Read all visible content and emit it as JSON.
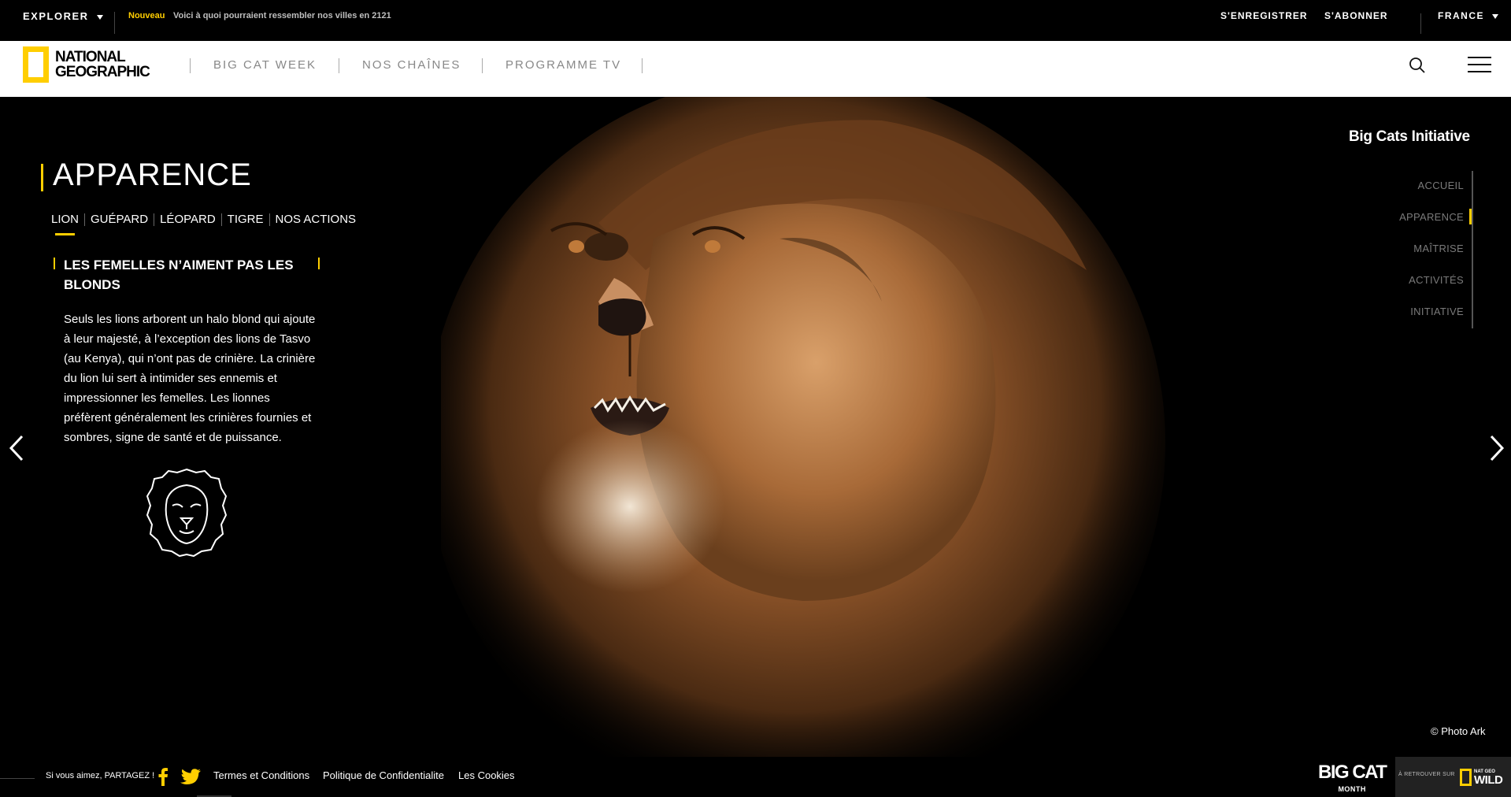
{
  "topbar": {
    "explore_label": "EXPLORER",
    "new_tag": "Nouveau",
    "new_text": "Voici à quoi pourraient ressembler nos villes en 2121",
    "register_label": "S'ENREGISTRER",
    "subscribe_label": "S'ABONNER",
    "country_label": "FRANCE"
  },
  "navbar": {
    "logo_line1": "NATIONAL",
    "logo_line2": "GEOGRAPHIC",
    "items": [
      "BIG CAT WEEK",
      "NOS CHAÎNES",
      "PROGRAMME TV"
    ]
  },
  "hero": {
    "section_title": "APPARENCE",
    "tabs": [
      "LION",
      "GUÉPARD",
      "LÉOPARD",
      "TIGRE",
      "NOS ACTIONS"
    ],
    "active_tab": "LION",
    "article_heading": "LES FEMELLES N’AIMENT PAS LES BLONDS",
    "article_body": "Seuls les lions arborent un halo blond qui ajoute à leur majesté, à l’exception des lions de Tasvo (au Kenya), qui n’ont pas de crinière. La crinière du lion lui sert à intimider ses ennemis et impressionner les femelles. Les lionnes préfèrent généralement les crinières fournies et sombres, signe de santé et de puissance.",
    "photo_credit": "© Photo Ark"
  },
  "side_nav": {
    "title": "Big Cats Initiative",
    "items": [
      "ACCUEIL",
      "APPARENCE",
      "MAÎTRISE",
      "ACTIVITÉS",
      "INITIATIVE"
    ],
    "active": "APPARENCE"
  },
  "footer": {
    "share_text": "Si vous aimez, PARTAGEZ !",
    "links": [
      "Termes et Conditions",
      "Politique de Confidentialite",
      "Les Cookies"
    ],
    "bigcat_line1": "BIG CAT",
    "bigcat_line2": "MONTH",
    "retrouver": "À RETROUVER SUR",
    "wild_mini": "NAT GEO",
    "wild_label": "WILD"
  },
  "colors": {
    "accent": "#ffce00",
    "background": "#000000",
    "nav_background": "#ffffff",
    "muted_text": "#888888"
  },
  "icons": [
    "chevron-down-icon",
    "search-icon",
    "hamburger-menu-icon",
    "chevron-left-icon",
    "chevron-right-icon",
    "lion-head-icon",
    "facebook-icon",
    "twitter-icon"
  ]
}
